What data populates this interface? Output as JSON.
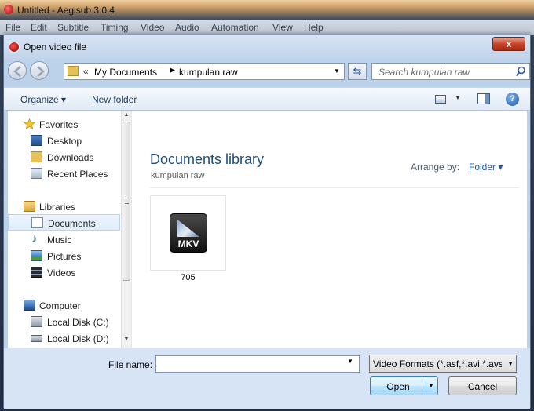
{
  "app": {
    "title": "Untitled - Aegisub 3.0.4",
    "menu": [
      "File",
      "Edit",
      "Subtitle",
      "Timing",
      "Video",
      "Audio",
      "Automation",
      "View",
      "Help"
    ]
  },
  "dialog": {
    "title": "Open video file",
    "close_label": "x",
    "address": {
      "chevron": "«",
      "parts": [
        "My Documents",
        "kumpulan raw"
      ]
    },
    "search_placeholder": "Search kumpulan raw",
    "toolbar": {
      "organize": "Organize ▾",
      "new_folder": "New folder",
      "help": "?"
    },
    "nav": {
      "items": [
        {
          "label": "Favorites",
          "icon": "star-icon"
        },
        {
          "label": "Desktop",
          "icon": "desktop-icon"
        },
        {
          "label": "Downloads",
          "icon": "downloads-icon"
        },
        {
          "label": "Recent Places",
          "icon": "recent-places-icon"
        },
        {
          "label": "Libraries",
          "icon": "libraries-icon"
        },
        {
          "label": "Documents",
          "icon": "documents-icon"
        },
        {
          "label": "Music",
          "icon": "music-icon"
        },
        {
          "label": "Pictures",
          "icon": "pictures-icon"
        },
        {
          "label": "Videos",
          "icon": "videos-icon"
        },
        {
          "label": "Computer",
          "icon": "computer-icon"
        },
        {
          "label": "Local Disk (C:)",
          "icon": "disk-icon"
        },
        {
          "label": "Local Disk (D:)",
          "icon": "disk-icon"
        }
      ],
      "selected": "Documents"
    },
    "content": {
      "library_title": "Documents library",
      "library_subtitle": "kumpulan raw",
      "arrange_label": "Arrange by:",
      "arrange_value": "Folder ▾",
      "files": [
        {
          "name": "705",
          "type_badge": "MKV"
        }
      ]
    },
    "bottom": {
      "filename_label": "File name:",
      "filename_value": "",
      "filter": "Video Formats (*.asf,*.avi,*.avs,",
      "open_label": "Open",
      "cancel_label": "Cancel"
    }
  },
  "colors": {
    "dialog_frame": "#bcd1ea",
    "link_blue": "#1e5aa8",
    "title_blue": "#1e4e79"
  }
}
